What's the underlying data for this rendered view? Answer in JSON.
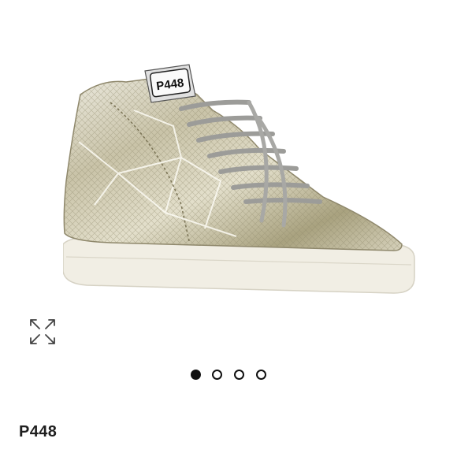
{
  "product": {
    "brand": "P448",
    "tongue_label": "P448"
  },
  "gallery": {
    "image_count": 4,
    "active_index": 0,
    "expand_icon": "expand-arrows-icon"
  },
  "colors": {
    "dot_active": "#111111",
    "brand_text": "#1f1f1f"
  }
}
